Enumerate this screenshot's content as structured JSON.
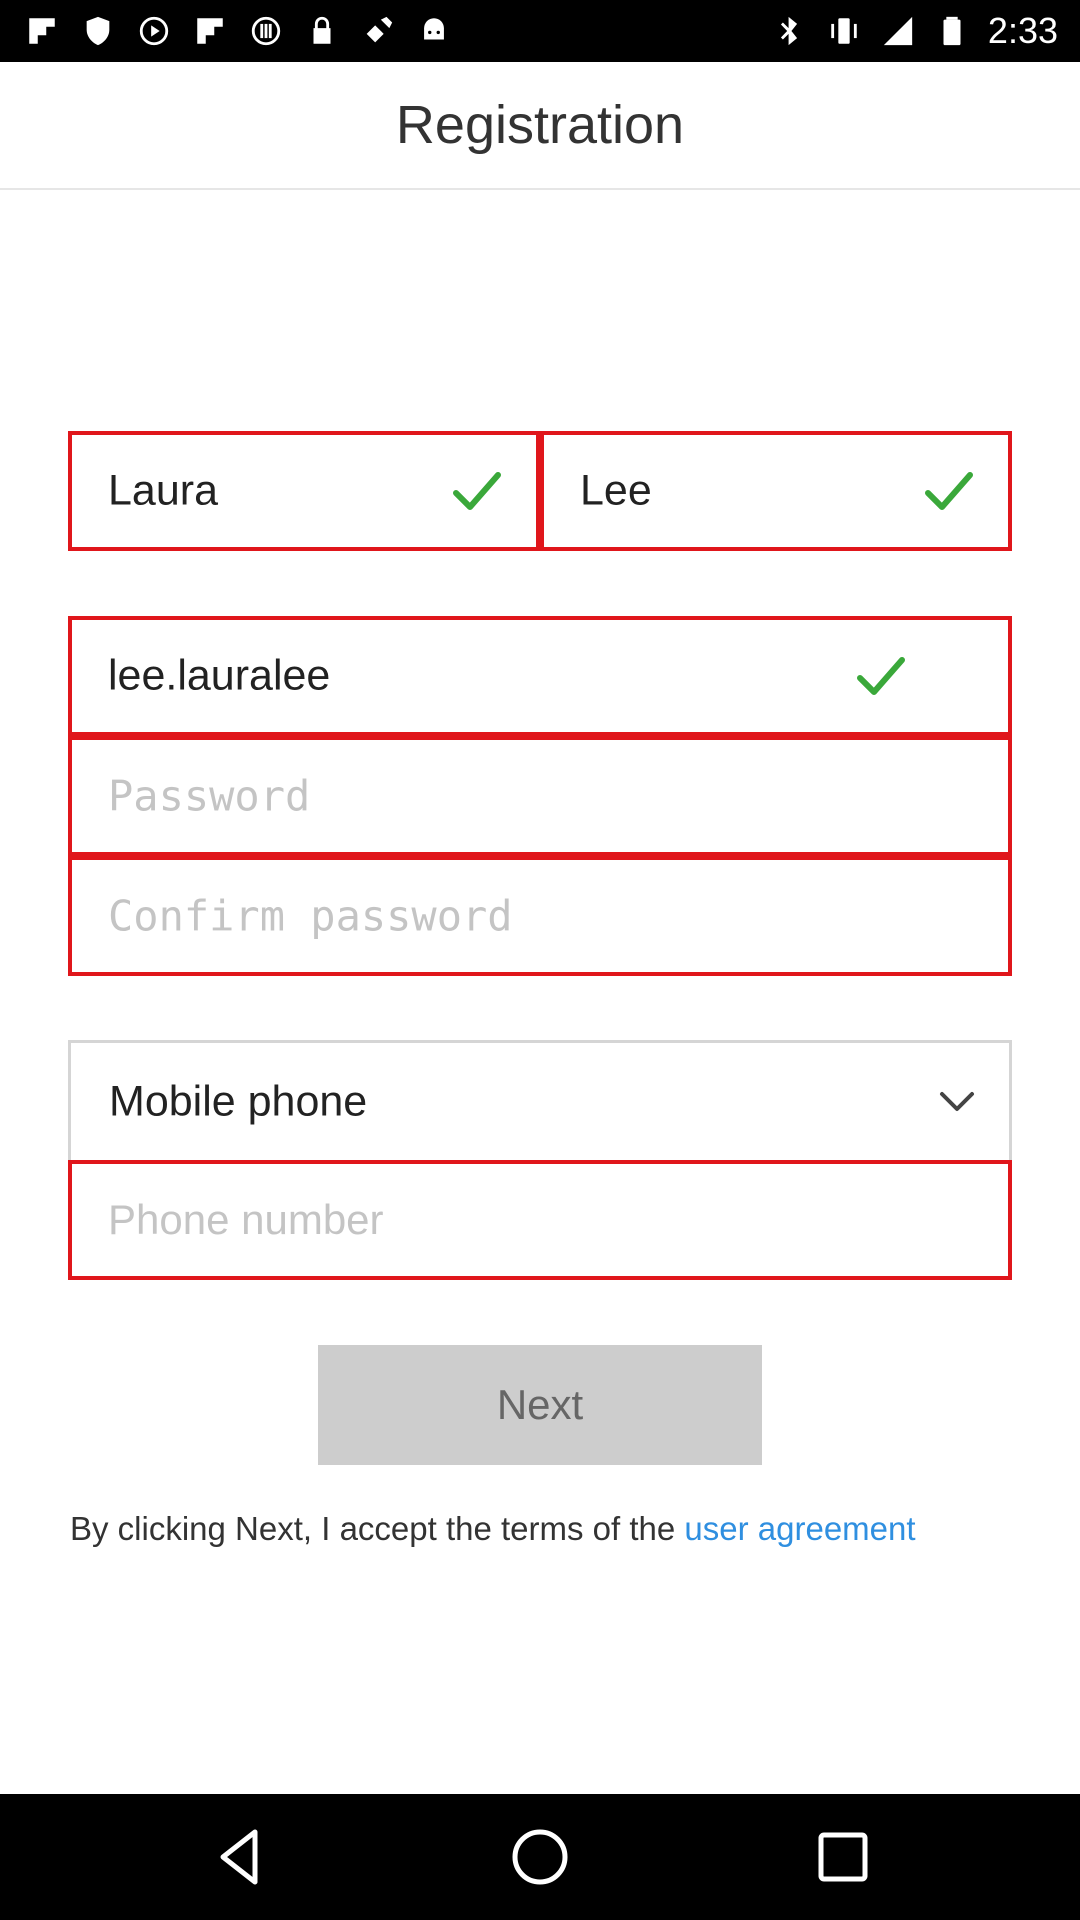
{
  "status_bar": {
    "time": "2:33",
    "left_icons": [
      "flipboard-icon",
      "shield-icon",
      "play-icon",
      "flipboard-icon",
      "settings-dots-icon",
      "lock-icon",
      "satellite-icon",
      "android-icon"
    ],
    "right_icons": [
      "bluetooth-icon",
      "vibrate-icon",
      "signal-icon",
      "battery-icon"
    ]
  },
  "header": {
    "title": "Registration"
  },
  "form": {
    "first_name": {
      "value": "Laura",
      "valid": true
    },
    "last_name": {
      "value": "Lee",
      "valid": true
    },
    "username": {
      "value": "lee.lauralee",
      "valid": true
    },
    "password": {
      "placeholder": "Password"
    },
    "confirm_password": {
      "placeholder": "Confirm password"
    },
    "contact_type": {
      "selected": "Mobile phone"
    },
    "phone": {
      "placeholder": "Phone number"
    },
    "next_label": "Next",
    "terms_text": "By clicking Next, I accept the terms of the ",
    "terms_link": "user agreement"
  },
  "colors": {
    "error_border": "#e0161b",
    "check": "#3aa83a",
    "link": "#2f8fe0",
    "disabled_button": "#cdcdcd"
  },
  "nav_bar": {
    "icons": [
      "back-icon",
      "home-icon",
      "recents-icon"
    ]
  }
}
